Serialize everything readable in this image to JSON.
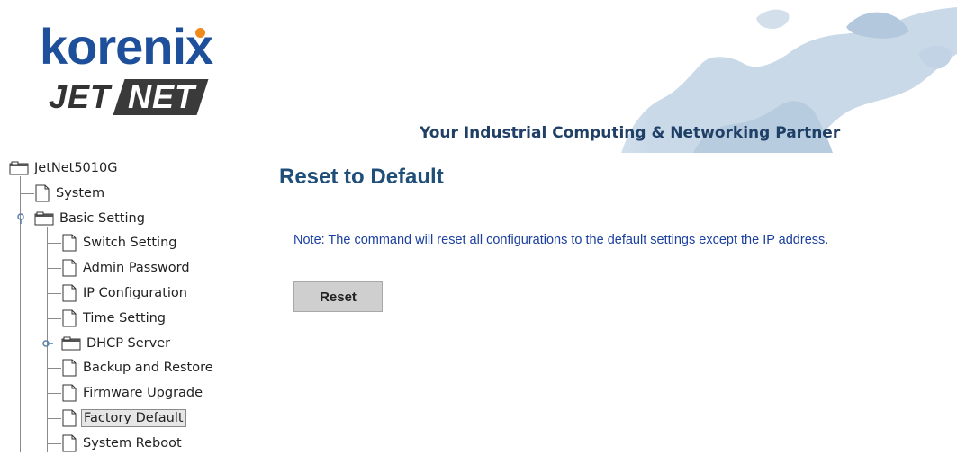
{
  "brand": {
    "logo_word": "korenix",
    "logo_jet": "JET",
    "logo_net": "NET",
    "tagline": "Your Industrial Computing & Networking Partner",
    "colors": {
      "logo_blue": "#1d4f9a",
      "logo_dot": "#f08a1c",
      "tagline": "#1f3f66"
    }
  },
  "tree": {
    "root": {
      "label": "JetNet5010G",
      "icon": "folder-icon"
    },
    "items": [
      {
        "label": "System",
        "icon": "document-icon"
      },
      {
        "label": "Basic Setting",
        "icon": "folder-icon",
        "expanded": true
      },
      {
        "label": "Switch Setting",
        "icon": "document-icon"
      },
      {
        "label": "Admin Password",
        "icon": "document-icon"
      },
      {
        "label": "IP Configuration",
        "icon": "document-icon"
      },
      {
        "label": "Time Setting",
        "icon": "document-icon"
      },
      {
        "label": "DHCP Server",
        "icon": "folder-icon",
        "expanded": false
      },
      {
        "label": "Backup and Restore",
        "icon": "document-icon"
      },
      {
        "label": "Firmware Upgrade",
        "icon": "document-icon"
      },
      {
        "label": "Factory Default",
        "icon": "document-icon",
        "selected": true
      },
      {
        "label": "System Reboot",
        "icon": "document-icon"
      }
    ]
  },
  "main": {
    "title": "Reset to Default",
    "note": "Note: The command will reset all configurations to the default settings except the IP address.",
    "reset_label": "Reset",
    "colors": {
      "title": "#1f4e79",
      "note": "#1a3f9e",
      "button_bg": "#cfcfcf"
    }
  }
}
